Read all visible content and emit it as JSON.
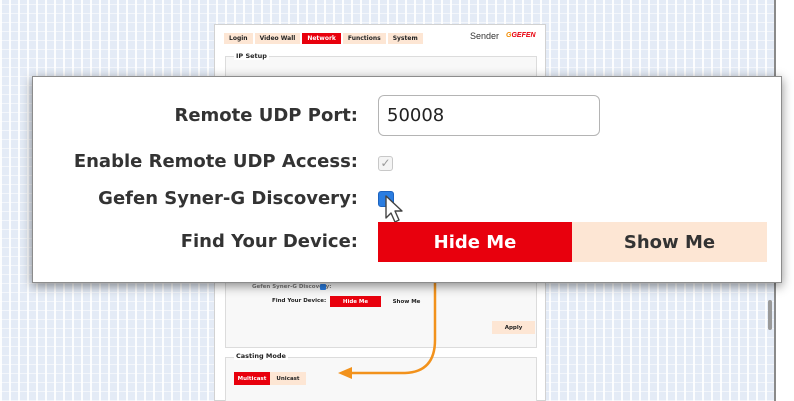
{
  "tabs": [
    {
      "label": "Login"
    },
    {
      "label": "Video Wall"
    },
    {
      "label": "Network"
    },
    {
      "label": "Functions"
    },
    {
      "label": "System"
    }
  ],
  "active_tab": "Network",
  "header": {
    "device_name": "Sender",
    "logo_text": "GEFEN"
  },
  "ip_setup": {
    "legend": "IP Setup"
  },
  "background_form": {
    "discovery_label": "Gefen Syner-G Discovery:",
    "find_label": "Find Your Device:",
    "hide_label": "Hide Me",
    "show_label": "Show Me",
    "apply_label": "Apply"
  },
  "casting_mode": {
    "legend": "Casting Mode",
    "multicast_label": "Multicast",
    "unicast_label": "Unicast",
    "selected": "Multicast"
  },
  "zoom": {
    "remote_udp_port_label": "Remote UDP Port:",
    "remote_udp_port_value": "50008",
    "enable_remote_udp_label": "Enable Remote UDP Access:",
    "enable_remote_udp_checked": true,
    "enable_remote_udp_disabled": true,
    "synerg_discovery_label": "Gefen Syner-G Discovery:",
    "synerg_discovery_checked": true,
    "find_device_label": "Find Your Device:",
    "hide_me_label": "Hide Me",
    "show_me_label": "Show Me",
    "find_device_selected": "Hide Me"
  },
  "colors": {
    "accent_red": "#e8000d",
    "peach": "#fde6d4",
    "checkbox_blue": "#2a7de1",
    "annotation_orange": "#f2921c"
  },
  "icons": {
    "cursor": "mouse-pointer-icon",
    "annotation_arrow": "curved-arrow-icon"
  }
}
